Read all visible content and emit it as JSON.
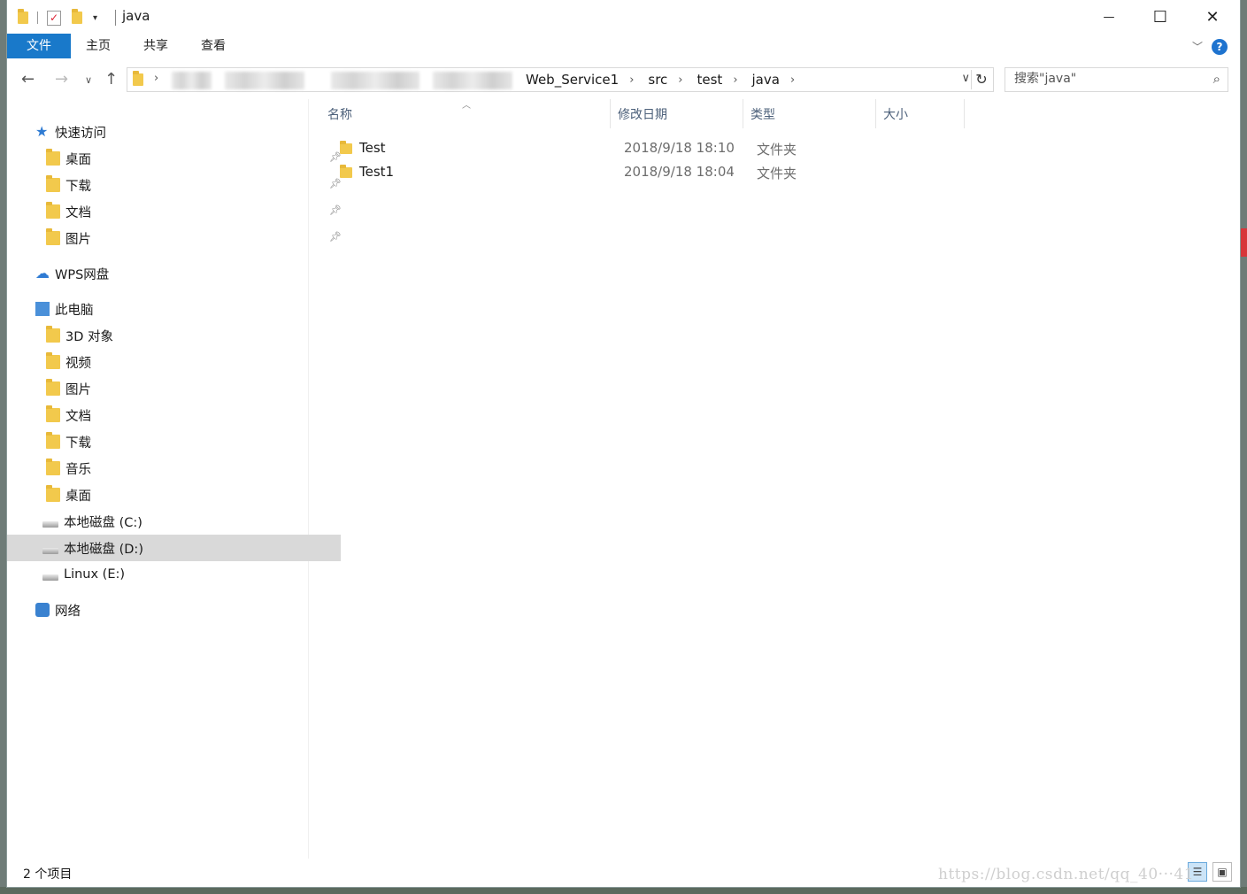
{
  "window": {
    "title": "java",
    "controls": {
      "minimize": "—",
      "maximize": "☐",
      "close": "✕"
    }
  },
  "ribbon": {
    "tabs": [
      {
        "label": "文件"
      },
      {
        "label": "主页"
      },
      {
        "label": "共享"
      },
      {
        "label": "查看"
      }
    ],
    "help": "?"
  },
  "address": {
    "path": [
      "Web_Service1",
      "src",
      "test",
      "java"
    ],
    "search_placeholder": "搜索\"java\""
  },
  "nav": {
    "quick_access": "快速访问",
    "quick_items": [
      "桌面",
      "下载",
      "文档",
      "图片"
    ],
    "wps": "WPS网盘",
    "this_pc": "此电脑",
    "pc_items": [
      "3D 对象",
      "视频",
      "图片",
      "文档",
      "下载",
      "音乐",
      "桌面",
      "本地磁盘 (C:)",
      "本地磁盘 (D:)",
      "Linux (E:)"
    ],
    "network": "网络"
  },
  "columns": {
    "name": "名称",
    "modified": "修改日期",
    "type": "类型",
    "size": "大小"
  },
  "files": [
    {
      "name": "Test",
      "modified": "2018/9/18 18:10",
      "type": "文件夹"
    },
    {
      "name": "Test1",
      "modified": "2018/9/18 18:04",
      "type": "文件夹"
    }
  ],
  "status": {
    "count": "2 个项目",
    "watermark": "https://blog.csdn.net/qq_40···41"
  },
  "icons": {
    "back": "arrow-left-icon",
    "forward": "arrow-right-icon",
    "up": "arrow-up-icon",
    "refresh": "refresh-icon",
    "search": "search-icon"
  }
}
